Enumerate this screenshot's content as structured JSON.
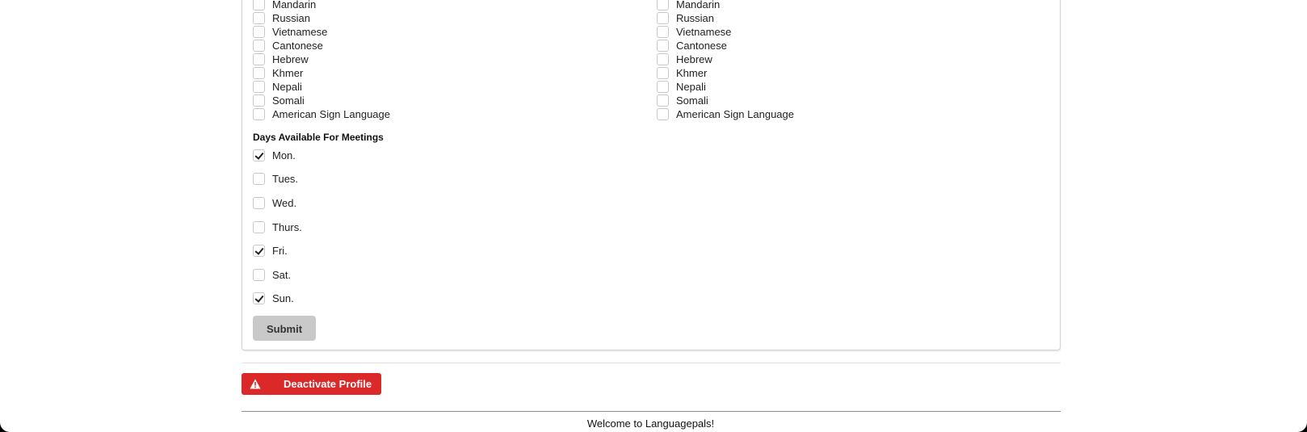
{
  "languages_left": [
    {
      "label": "Mandarin",
      "checked": false
    },
    {
      "label": "Russian",
      "checked": false
    },
    {
      "label": "Vietnamese",
      "checked": false
    },
    {
      "label": "Cantonese",
      "checked": false
    },
    {
      "label": "Hebrew",
      "checked": false
    },
    {
      "label": "Khmer",
      "checked": false
    },
    {
      "label": "Nepali",
      "checked": false
    },
    {
      "label": "Somali",
      "checked": false
    },
    {
      "label": "American Sign Language",
      "checked": false
    }
  ],
  "languages_right": [
    {
      "label": "Mandarin",
      "checked": false
    },
    {
      "label": "Russian",
      "checked": false
    },
    {
      "label": "Vietnamese",
      "checked": false
    },
    {
      "label": "Cantonese",
      "checked": false
    },
    {
      "label": "Hebrew",
      "checked": false
    },
    {
      "label": "Khmer",
      "checked": false
    },
    {
      "label": "Nepali",
      "checked": false
    },
    {
      "label": "Somali",
      "checked": false
    },
    {
      "label": "American Sign Language",
      "checked": false
    }
  ],
  "days_section": {
    "title": "Days Available For Meetings",
    "days": [
      {
        "label": "Mon.",
        "checked": true
      },
      {
        "label": "Tues.",
        "checked": false
      },
      {
        "label": "Wed.",
        "checked": false
      },
      {
        "label": "Thurs.",
        "checked": false
      },
      {
        "label": "Fri.",
        "checked": true
      },
      {
        "label": "Sat.",
        "checked": false
      },
      {
        "label": "Sun.",
        "checked": true
      }
    ]
  },
  "submit_label": "Submit",
  "deactivate": {
    "label": "Deactivate Profile",
    "icon": "warning-icon",
    "color": "#db2828"
  },
  "footer": {
    "text": "Welcome to Languagepals!"
  }
}
